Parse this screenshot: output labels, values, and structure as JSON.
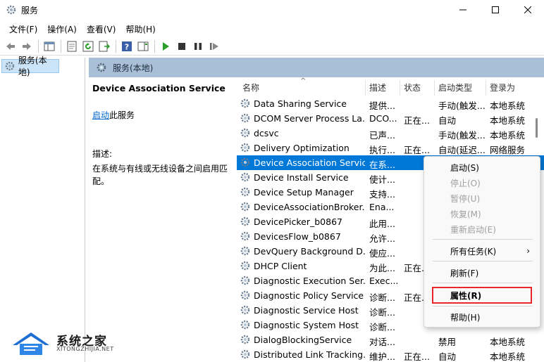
{
  "window": {
    "title": "服务"
  },
  "menubar": [
    "文件(F)",
    "操作(A)",
    "查看(V)",
    "帮助(H)"
  ],
  "tree": {
    "selected_label": "服务(本地)"
  },
  "panel": {
    "header": "服务(本地)",
    "service_title": "Device Association Service",
    "start_link": "启动",
    "start_suffix": "此服务",
    "desc_label": "描述:",
    "desc_text": "在系统与有线或无线设备之间启用匹配。"
  },
  "table": {
    "columns": [
      "名称",
      "描述",
      "状态",
      "启动类型",
      "登录为"
    ],
    "rows": [
      {
        "name": "Data Sharing Service",
        "desc": "提供...",
        "status": "",
        "startup": "手动(触发...",
        "logon": "本地系统"
      },
      {
        "name": "DCOM Server Process La...",
        "desc": "DCO...",
        "status": "正在...",
        "startup": "自动",
        "logon": "本地系统"
      },
      {
        "name": "dcsvc",
        "desc": "已声...",
        "status": "",
        "startup": "手动(触发...",
        "logon": "本地系统"
      },
      {
        "name": "Delivery Optimization",
        "desc": "执行...",
        "status": "正在...",
        "startup": "自动(延迟...",
        "logon": "网络服务"
      },
      {
        "name": "Device Association Service",
        "desc": "在系...",
        "status": "",
        "startup": "",
        "logon": ""
      },
      {
        "name": "Device Install Service",
        "desc": "使计...",
        "status": "",
        "startup": "",
        "logon": ""
      },
      {
        "name": "Device Setup Manager",
        "desc": "支持...",
        "status": "",
        "startup": "",
        "logon": ""
      },
      {
        "name": "DeviceAssociationBroker...",
        "desc": "Ena...",
        "status": "",
        "startup": "",
        "logon": ""
      },
      {
        "name": "DevicePicker_b0867",
        "desc": "此用...",
        "status": "",
        "startup": "",
        "logon": ""
      },
      {
        "name": "DevicesFlow_b0867",
        "desc": "允许...",
        "status": "",
        "startup": "",
        "logon": ""
      },
      {
        "name": "DevQuery Background D...",
        "desc": "使应...",
        "status": "",
        "startup": "",
        "logon": ""
      },
      {
        "name": "DHCP Client",
        "desc": "为此...",
        "status": "正在...",
        "startup": "",
        "logon": ""
      },
      {
        "name": "Diagnostic Execution Ser...",
        "desc": "Exec...",
        "status": "",
        "startup": "",
        "logon": ""
      },
      {
        "name": "Diagnostic Policy Service",
        "desc": "诊断...",
        "status": "正在...",
        "startup": "",
        "logon": ""
      },
      {
        "name": "Diagnostic Service Host",
        "desc": "诊断...",
        "status": "",
        "startup": "",
        "logon": ""
      },
      {
        "name": "Diagnostic System Host",
        "desc": "诊断...",
        "status": "",
        "startup": "",
        "logon": ""
      },
      {
        "name": "DialogBlockingService",
        "desc": "对话...",
        "status": "",
        "startup": "禁用",
        "logon": "本地系统"
      },
      {
        "name": "Distributed Link Tracking...",
        "desc": "维护...",
        "status": "正在...",
        "startup": "自动",
        "logon": "本地系统"
      }
    ]
  },
  "context_menu": {
    "items": [
      {
        "label": "启动(S)",
        "disabled": false
      },
      {
        "label": "停止(O)",
        "disabled": true
      },
      {
        "label": "暂停(U)",
        "disabled": true
      },
      {
        "label": "恢复(M)",
        "disabled": true
      },
      {
        "label": "重新启动(E)",
        "disabled": true
      },
      {
        "label": "所有任务(K)",
        "disabled": false
      },
      {
        "label": "刷新(F)",
        "disabled": false
      },
      {
        "label": "属性(R)",
        "disabled": false
      },
      {
        "label": "帮助(H)",
        "disabled": false
      }
    ]
  },
  "watermark": {
    "title": "系统之家",
    "subtitle": "XITONGZHIJIA.NET"
  },
  "colors": {
    "selection": "#0078d7",
    "panel_header": "#a9bfd7",
    "highlight_box": "#e8262b",
    "link": "#0066cc"
  }
}
